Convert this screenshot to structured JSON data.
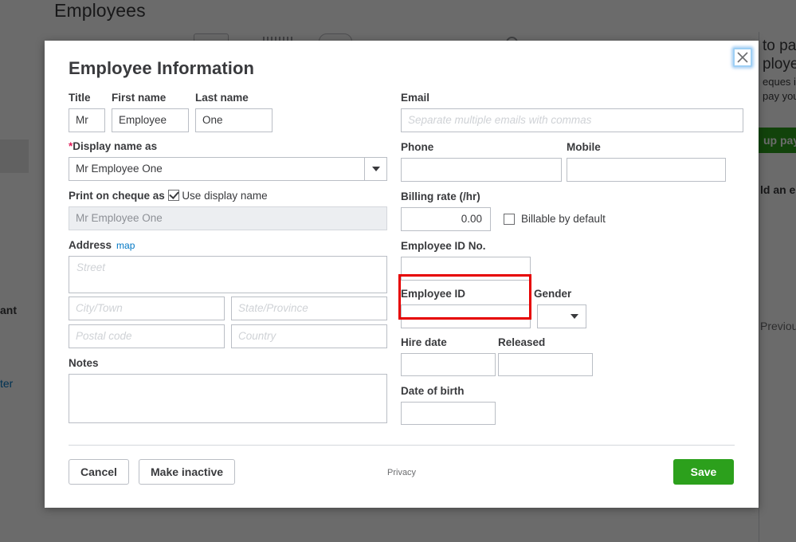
{
  "background": {
    "page_title": "Employees",
    "right_panel_lines": [
      "to pa",
      "ploye",
      "eques i",
      "pay you"
    ],
    "green_button_label": "up pay",
    "add_employee_text": "ld an e",
    "previous_label": "Previous",
    "left_text": "ant",
    "left_link": "ter"
  },
  "modal": {
    "title": "Employee Information",
    "close_icon": "close-icon",
    "left": {
      "title_label": "Title",
      "title_value": "Mr",
      "first_name_label": "First name",
      "first_name_value": "Employee",
      "last_name_label": "Last name",
      "last_name_value": "One",
      "display_name_label": "Display name as",
      "display_name_required": "*",
      "display_name_value": "Mr Employee One",
      "print_on_cheque_label": "Print on cheque as",
      "use_display_name_label": "Use display name",
      "use_display_name_checked": true,
      "print_on_cheque_value": "Mr Employee One",
      "address_label": "Address",
      "map_link": "map",
      "street_placeholder": "Street",
      "city_placeholder": "City/Town",
      "state_placeholder": "State/Province",
      "postal_placeholder": "Postal code",
      "country_placeholder": "Country",
      "notes_label": "Notes",
      "notes_value": ""
    },
    "right": {
      "email_label": "Email",
      "email_placeholder": "Separate multiple emails with commas",
      "email_value": "",
      "phone_label": "Phone",
      "phone_value": "",
      "mobile_label": "Mobile",
      "mobile_value": "",
      "billing_rate_label": "Billing rate (/hr)",
      "billing_rate_value": "0.00",
      "billable_label": "Billable by default",
      "billable_checked": false,
      "employee_id_no_label": "Employee ID No.",
      "employee_id_no_value": "",
      "employee_id_label": "Employee ID",
      "employee_id_value": "",
      "gender_label": "Gender",
      "gender_value": "",
      "hire_date_label": "Hire date",
      "hire_date_value": "",
      "released_label": "Released",
      "released_value": "",
      "date_of_birth_label": "Date of birth",
      "date_of_birth_value": ""
    },
    "footer": {
      "cancel_label": "Cancel",
      "make_inactive_label": "Make inactive",
      "privacy_label": "Privacy",
      "save_label": "Save"
    }
  },
  "colors": {
    "accent_green": "#2ca01c",
    "link_blue": "#0077c5",
    "required_red": "#e01e5a",
    "annotation_red": "#e60000",
    "text_dark": "#393a3d",
    "border_grey": "#babec5",
    "overlay": "rgba(0,0,0,0.58)"
  }
}
